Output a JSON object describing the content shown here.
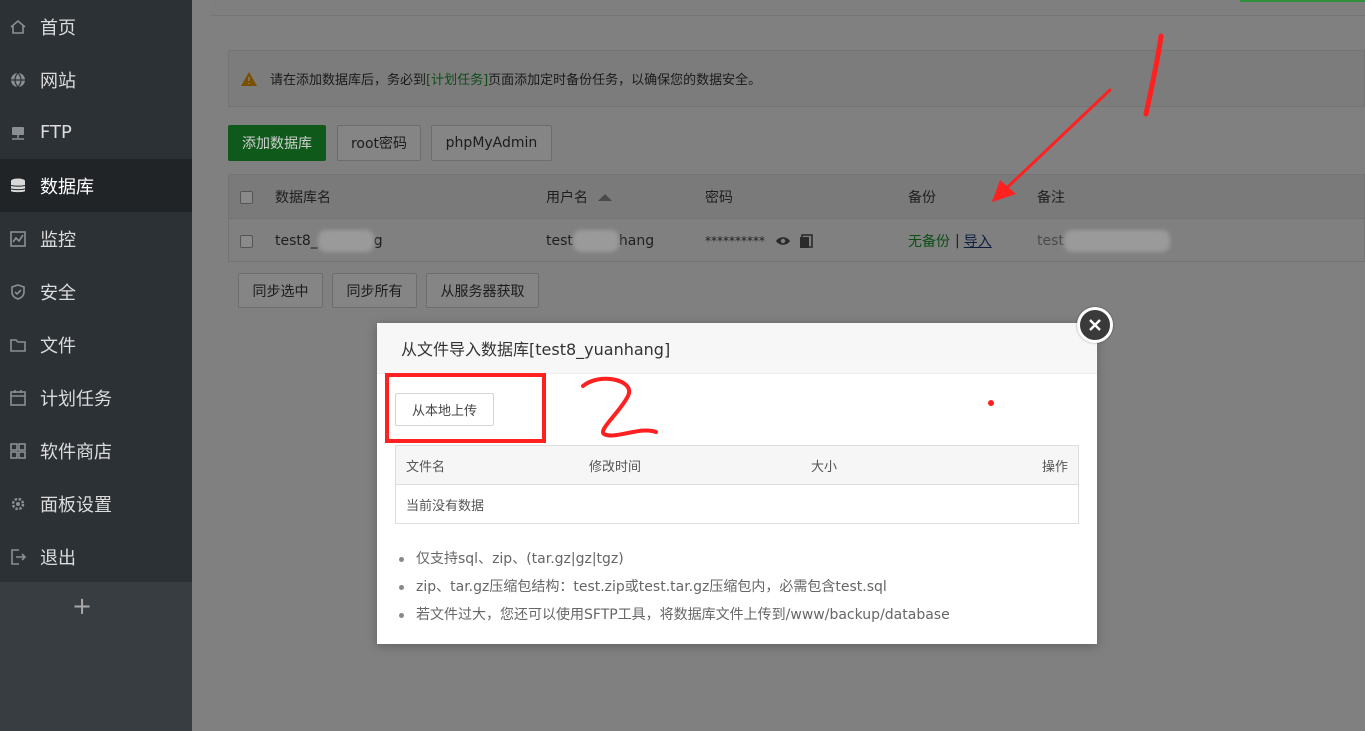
{
  "sidebar": {
    "items": [
      {
        "label": "首页",
        "icon": "home-icon"
      },
      {
        "label": "网站",
        "icon": "globe-icon"
      },
      {
        "label": "FTP",
        "icon": "ftp-icon"
      },
      {
        "label": "数据库",
        "icon": "database-icon"
      },
      {
        "label": "监控",
        "icon": "monitor-icon"
      },
      {
        "label": "安全",
        "icon": "shield-icon"
      },
      {
        "label": "文件",
        "icon": "folder-icon"
      },
      {
        "label": "计划任务",
        "icon": "calendar-icon"
      },
      {
        "label": "软件商店",
        "icon": "grid-icon"
      },
      {
        "label": "面板设置",
        "icon": "gear-icon"
      },
      {
        "label": "退出",
        "icon": "logout-icon"
      }
    ],
    "active_index": 3,
    "add_label": "+"
  },
  "alert": {
    "text_before": "请在添加数据库后，务必到",
    "link": "[计划任务]",
    "text_after": "页面添加定时备份任务，以确保您的数据安全。",
    "icon": "warning-icon"
  },
  "toolbar": {
    "add_db": "添加数据库",
    "root_pwd": "root密码",
    "phpmyadmin": "phpMyAdmin"
  },
  "db_table": {
    "headers": {
      "name": "数据库名",
      "user": "用户名",
      "password": "密码",
      "backup": "备份",
      "note": "备注"
    },
    "row": {
      "name_prefix": "test8_",
      "name_suffix": "g",
      "user_prefix": "test",
      "user_suffix": "hang",
      "password": "**********",
      "backup_status": "无备份",
      "separator": "|",
      "import": "导入",
      "note_prefix": "test"
    }
  },
  "actions": {
    "sync_selected": "同步选中",
    "sync_all": "同步所有",
    "fetch_server": "从服务器获取"
  },
  "modal": {
    "title": "从文件导入数据库[test8_yuanhang]",
    "upload_button": "从本地上传",
    "file_table": {
      "headers": {
        "name": "文件名",
        "mtime": "修改时间",
        "size": "大小",
        "ops": "操作"
      },
      "empty": "当前没有数据"
    },
    "tips": [
      "仅支持sql、zip、(tar.gz|gz|tgz)",
      "zip、tar.gz压缩包结构：test.zip或test.tar.gz压缩包内，必需包含test.sql",
      "若文件过大，您还可以使用SFTP工具，将数据库文件上传到/www/backup/database"
    ]
  },
  "colors": {
    "sidebar_bg": "#2c3136",
    "sidebar_active": "#202427",
    "accent_green": "#20a53a",
    "annotation_red": "#ff2020"
  }
}
